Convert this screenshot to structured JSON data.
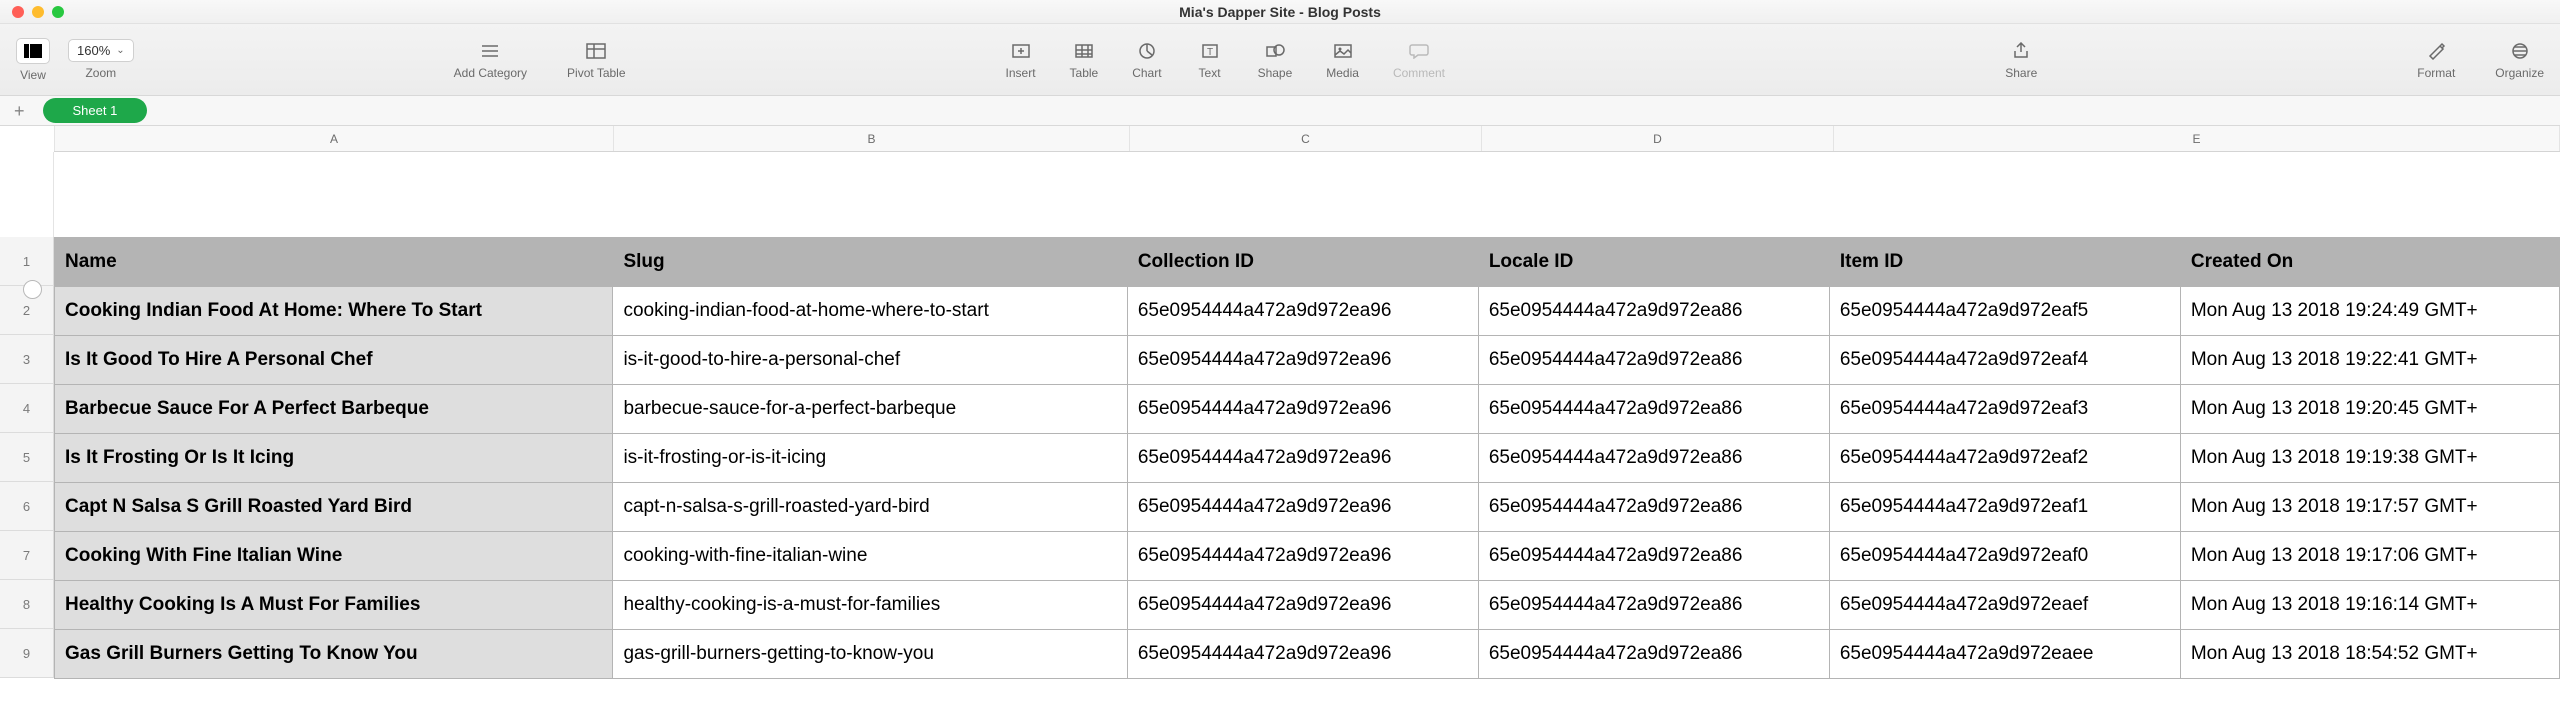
{
  "window": {
    "title": "Mia's Dapper Site - Blog Posts"
  },
  "toolbar": {
    "view": "View",
    "zoom_value": "160%",
    "zoom_label": "Zoom",
    "add_category": "Add Category",
    "pivot_table": "Pivot Table",
    "insert": "Insert",
    "table": "Table",
    "chart": "Chart",
    "text": "Text",
    "shape": "Shape",
    "media": "Media",
    "comment": "Comment",
    "share": "Share",
    "format": "Format",
    "organize": "Organize"
  },
  "sheet": {
    "tab1": "Sheet 1"
  },
  "cols": {
    "a": "A",
    "b": "B",
    "c": "C",
    "d": "D",
    "e": "E"
  },
  "rownums": {
    "r1": "1",
    "r2": "2",
    "r3": "3",
    "r4": "4",
    "r5": "5",
    "r6": "6",
    "r7": "7",
    "r8": "8",
    "r9": "9"
  },
  "headers": {
    "name": "Name",
    "slug": "Slug",
    "collection": "Collection ID",
    "locale": "Locale ID",
    "item": "Item ID",
    "created": "Created On"
  },
  "rows": [
    {
      "name": "Cooking Indian Food At Home: Where To Start",
      "slug": "cooking-indian-food-at-home-where-to-start",
      "coll": "65e0954444a472a9d972ea96",
      "loc": "65e0954444a472a9d972ea86",
      "item": "65e0954444a472a9d972eaf5",
      "created": "Mon Aug 13 2018 19:24:49 GMT+"
    },
    {
      "name": "Is It Good To Hire A Personal Chef",
      "slug": "is-it-good-to-hire-a-personal-chef",
      "coll": "65e0954444a472a9d972ea96",
      "loc": "65e0954444a472a9d972ea86",
      "item": "65e0954444a472a9d972eaf4",
      "created": "Mon Aug 13 2018 19:22:41 GMT+"
    },
    {
      "name": "Barbecue Sauce For A Perfect Barbeque",
      "slug": "barbecue-sauce-for-a-perfect-barbeque",
      "coll": "65e0954444a472a9d972ea96",
      "loc": "65e0954444a472a9d972ea86",
      "item": "65e0954444a472a9d972eaf3",
      "created": "Mon Aug 13 2018 19:20:45 GMT+"
    },
    {
      "name": "Is It Frosting Or Is It Icing",
      "slug": "is-it-frosting-or-is-it-icing",
      "coll": "65e0954444a472a9d972ea96",
      "loc": "65e0954444a472a9d972ea86",
      "item": "65e0954444a472a9d972eaf2",
      "created": "Mon Aug 13 2018 19:19:38 GMT+"
    },
    {
      "name": "Capt N Salsa S Grill Roasted Yard Bird",
      "slug": "capt-n-salsa-s-grill-roasted-yard-bird",
      "coll": "65e0954444a472a9d972ea96",
      "loc": "65e0954444a472a9d972ea86",
      "item": "65e0954444a472a9d972eaf1",
      "created": "Mon Aug 13 2018 19:17:57 GMT+"
    },
    {
      "name": "Cooking With Fine Italian Wine",
      "slug": "cooking-with-fine-italian-wine",
      "coll": "65e0954444a472a9d972ea96",
      "loc": "65e0954444a472a9d972ea86",
      "item": "65e0954444a472a9d972eaf0",
      "created": "Mon Aug 13 2018 19:17:06 GMT+"
    },
    {
      "name": "Healthy Cooking Is A Must For Families",
      "slug": "healthy-cooking-is-a-must-for-families",
      "coll": "65e0954444a472a9d972ea96",
      "loc": "65e0954444a472a9d972ea86",
      "item": "65e0954444a472a9d972eaef",
      "created": "Mon Aug 13 2018 19:16:14 GMT+"
    },
    {
      "name": "Gas Grill Burners Getting To Know You",
      "slug": "gas-grill-burners-getting-to-know-you",
      "coll": "65e0954444a472a9d972ea96",
      "loc": "65e0954444a472a9d972ea86",
      "item": "65e0954444a472a9d972eaee",
      "created": "Mon Aug 13 2018 18:54:52 GMT+"
    }
  ]
}
